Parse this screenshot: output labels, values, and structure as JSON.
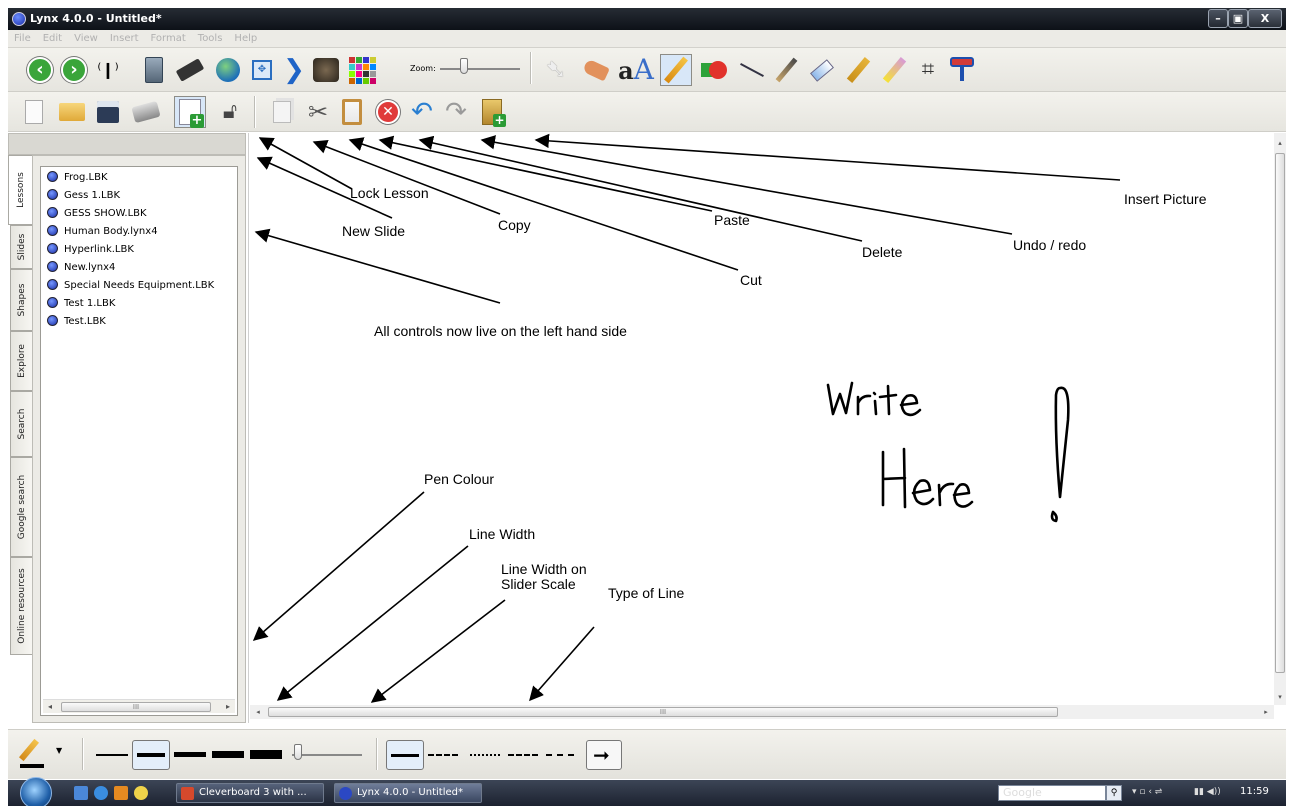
{
  "window": {
    "title": "Lynx 4.0.0 - Untitled*",
    "min_label": "–",
    "max_label": "▣",
    "close_label": "X"
  },
  "menu": [
    "File",
    "Edit",
    "View",
    "Insert",
    "Format",
    "Tools",
    "Help"
  ],
  "toolbar1": {
    "zoom_label": "Zoom:",
    "icons": [
      "back-icon",
      "forward-icon",
      "microphone-icon",
      "calculator-icon",
      "keyboard-icon",
      "globe-icon",
      "fit-screen-icon",
      "next-chevron-icon",
      "camera-icon",
      "color-grid-icon",
      "pointer-icon",
      "hand-icon",
      "text-icon",
      "pen-icon",
      "shapes-icon",
      "line-icon",
      "brush-icon",
      "eraser-icon",
      "highlighter-icon",
      "yellow-highlighter-icon",
      "crop-icon",
      "paint-roller-icon"
    ]
  },
  "toolbar2": {
    "icons": [
      "new-file-icon",
      "open-folder-icon",
      "save-icon",
      "print-icon",
      "new-slide-icon",
      "lock-icon",
      "copy-icon",
      "cut-icon",
      "paste-icon",
      "delete-icon",
      "undo-icon",
      "redo-icon",
      "insert-picture-icon"
    ]
  },
  "side_tabs": [
    "Lessons",
    "Slides",
    "Shapes",
    "Explore",
    "Search",
    "Google search",
    "Online resources"
  ],
  "lessons": [
    "Frog.LBK",
    "Gess 1.LBK",
    "GESS SHOW.LBK",
    "Human Body.lynx4",
    "Hyperlink.LBK",
    "New.lynx4",
    "Special Needs Equipment.LBK",
    "Test 1.LBK",
    "Test.LBK"
  ],
  "scroll_glyph": "III",
  "annotations": {
    "lock_lesson": "Lock Lesson",
    "new_slide": "New Slide",
    "copy": "Copy",
    "cut": "Cut",
    "paste": "Paste",
    "delete": "Delete",
    "undo_redo": "Undo / redo",
    "insert_picture": "Insert Picture",
    "all_controls": "All controls now live on the left hand side",
    "pen_colour": "Pen Colour",
    "line_width": "Line Width",
    "line_width_slider_1": "Line Width on",
    "line_width_slider_2": "Slider Scale",
    "type_of_line": "Type of Line"
  },
  "handwriting": {
    "line1": "Write",
    "line2": "Here",
    "mark": "!"
  },
  "taskbar": {
    "task1": "Cleverboard 3 with ...",
    "task2": "Lynx 4.0.0 - Untitled*",
    "search_placeholder": "Google",
    "clock": "11:59"
  }
}
